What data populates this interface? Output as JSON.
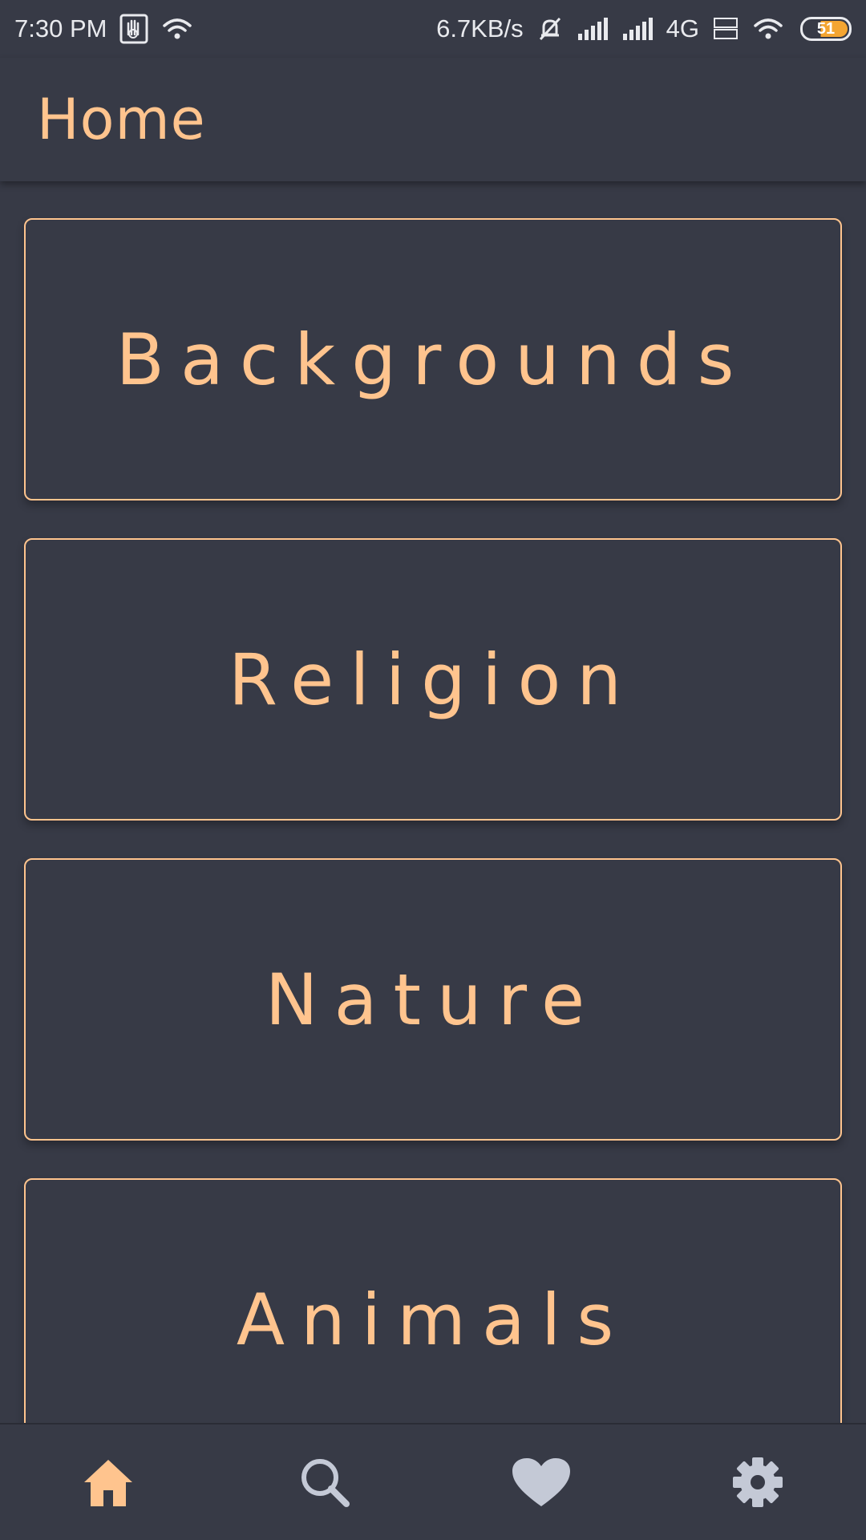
{
  "status_bar": {
    "time": "7:30 PM",
    "speed": "6.7KB/s",
    "network": "4G",
    "battery": "51",
    "icons": [
      "hand-notification-icon",
      "wifi-icon",
      "mute-bell-icon",
      "signal-icon",
      "signal-icon",
      "volte-icon",
      "wifi-icon",
      "battery-icon"
    ]
  },
  "app_bar": {
    "title": "Home"
  },
  "categories": [
    {
      "label": "Backgrounds"
    },
    {
      "label": "Religion"
    },
    {
      "label": "Nature"
    },
    {
      "label": "Animals"
    }
  ],
  "bottom_nav": {
    "items": [
      {
        "icon": "home-icon",
        "active": true
      },
      {
        "icon": "search-icon",
        "active": false
      },
      {
        "icon": "heart-icon",
        "active": false
      },
      {
        "icon": "settings-icon",
        "active": false
      }
    ]
  },
  "colors": {
    "background": "#373a46",
    "accent": "#ffc48e",
    "inactive_icon": "#c4c9d6",
    "status_text": "#e9eaee"
  }
}
